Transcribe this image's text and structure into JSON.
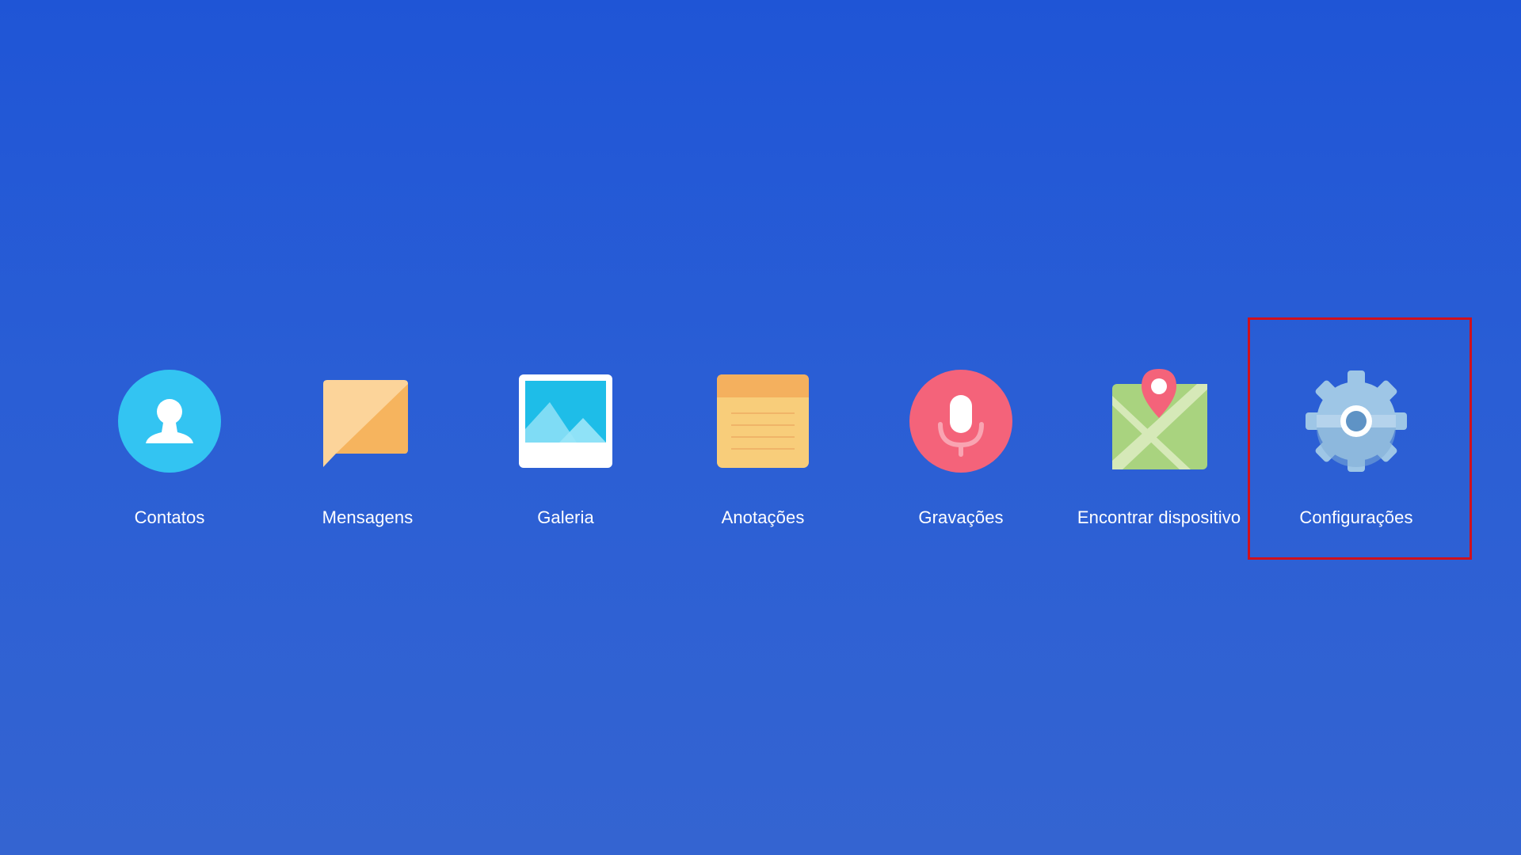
{
  "desktop": {
    "background_top": "#1f55d6",
    "background_bottom": "#3464d1",
    "selection_color": "#d0101c",
    "selected_app": "Configurações",
    "apps": [
      {
        "label": "Contatos",
        "icon": "contacts-icon",
        "color": "#33c4f2"
      },
      {
        "label": "Mensagens",
        "icon": "messages-icon",
        "color": "#f6b45e"
      },
      {
        "label": "Galeria",
        "icon": "gallery-icon",
        "color": "#1ebde8"
      },
      {
        "label": "Anotações",
        "icon": "notes-icon",
        "color": "#f8cd7a"
      },
      {
        "label": "Gravações",
        "icon": "recorder-icon",
        "color": "#f4637a"
      },
      {
        "label": "Encontrar dispositivo",
        "icon": "find-device-icon",
        "color": "#a9d37f"
      },
      {
        "label": "Configurações",
        "icon": "settings-icon",
        "color": "#9ec6e6"
      }
    ]
  }
}
